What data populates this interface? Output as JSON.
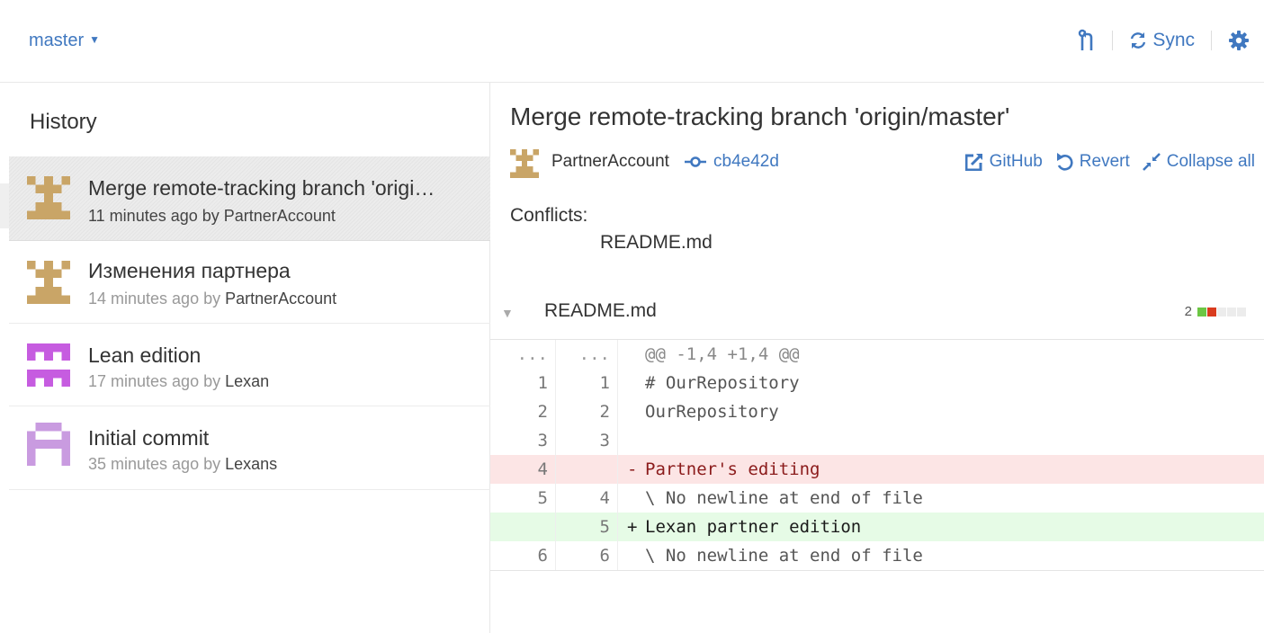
{
  "header": {
    "branch": "master",
    "sync_label": "Sync"
  },
  "history": {
    "title": "History",
    "commits": [
      {
        "title": "Merge remote-tracking branch 'origi…",
        "time": "11 minutes ago by",
        "author": "PartnerAccount"
      },
      {
        "title": "Изменения партнера",
        "time": "14 minutes ago by",
        "author": "PartnerAccount"
      },
      {
        "title": "Lean edition",
        "time": "17 minutes ago by",
        "author": "Lexan"
      },
      {
        "title": "Initial commit",
        "time": "35 minutes ago by",
        "author": "Lexans"
      }
    ]
  },
  "detail": {
    "title": "Merge remote-tracking branch 'origin/master'",
    "author": "PartnerAccount",
    "sha": "cb4e42d",
    "actions": {
      "github": "GitHub",
      "revert": "Revert",
      "collapse": "Collapse all"
    },
    "conflicts_label": "Conflicts:",
    "conflict_file": "README.md",
    "file": {
      "name": "README.md",
      "changes": "2"
    },
    "diff": [
      {
        "type": "hunk",
        "old": "...",
        "new": "...",
        "mark": "",
        "text": "@@ -1,4 +1,4 @@"
      },
      {
        "type": "ctx",
        "old": "1",
        "new": "1",
        "mark": "",
        "text": "# OurRepository"
      },
      {
        "type": "ctx",
        "old": "2",
        "new": "2",
        "mark": "",
        "text": "OurRepository"
      },
      {
        "type": "ctx",
        "old": "3",
        "new": "3",
        "mark": "",
        "text": ""
      },
      {
        "type": "del",
        "old": "4",
        "new": "",
        "mark": "-",
        "text": "Partner's editing"
      },
      {
        "type": "ctx",
        "old": "5",
        "new": "4",
        "mark": "",
        "text": "\\ No newline at end of file"
      },
      {
        "type": "add",
        "old": "",
        "new": "5",
        "mark": "+",
        "text": "Lexan partner edition"
      },
      {
        "type": "ctx",
        "old": "6",
        "new": "6",
        "mark": "",
        "text": "\\ No newline at end of file"
      }
    ]
  },
  "colors": {
    "accent": "#4078c0",
    "added": "#6cc644",
    "removed": "#d93b1e",
    "neutral": "#e8e8e8",
    "avatar_tan": "#c9a567",
    "avatar_violet": "#c65ce0",
    "avatar_lilac": "#c99be0"
  }
}
